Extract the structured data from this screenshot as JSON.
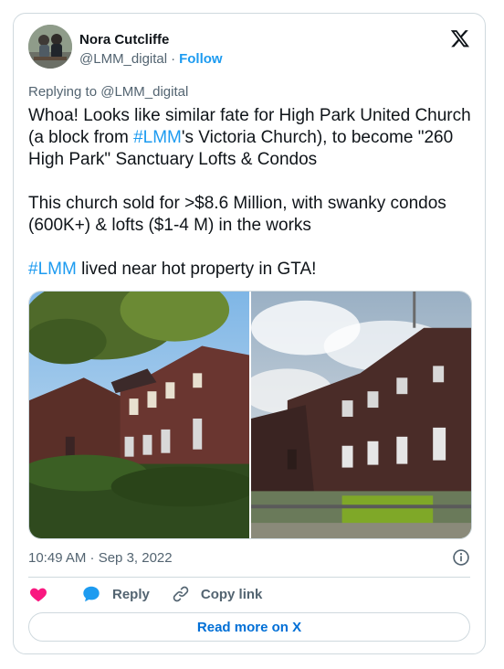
{
  "author": {
    "name": "Nora Cutcliffe",
    "handle": "@LMM_digital",
    "separator": "·",
    "follow_label": "Follow"
  },
  "replying_to": "Replying to @LMM_digital",
  "tweet": {
    "p1": {
      "t1": "Whoa! Looks like similar fate for  High Park United Church (a block from ",
      "tag": "#LMM",
      "t2": "'s Victoria Church), to become \"260 High Park\" Sanctuary Lofts & Condos"
    },
    "p2": "This church sold for >$8.6 Million, with swanky condos (600K+) & lofts ($1-4 M) in the works",
    "p3": {
      "tag": "#LMM",
      "t": " lived near hot property in GTA!"
    }
  },
  "timestamp": "10:49 AM · Sep 3, 2022",
  "actions": {
    "reply": "Reply",
    "copy_link": "Copy link"
  },
  "read_more": "Read more on X",
  "colors": {
    "link": "#1d9bf0",
    "heart": "#f91880",
    "muted": "#536471",
    "border": "#cfd9de"
  },
  "icons": [
    "x-logo-icon",
    "info-icon",
    "heart-icon",
    "reply-bubble-icon",
    "link-icon"
  ]
}
